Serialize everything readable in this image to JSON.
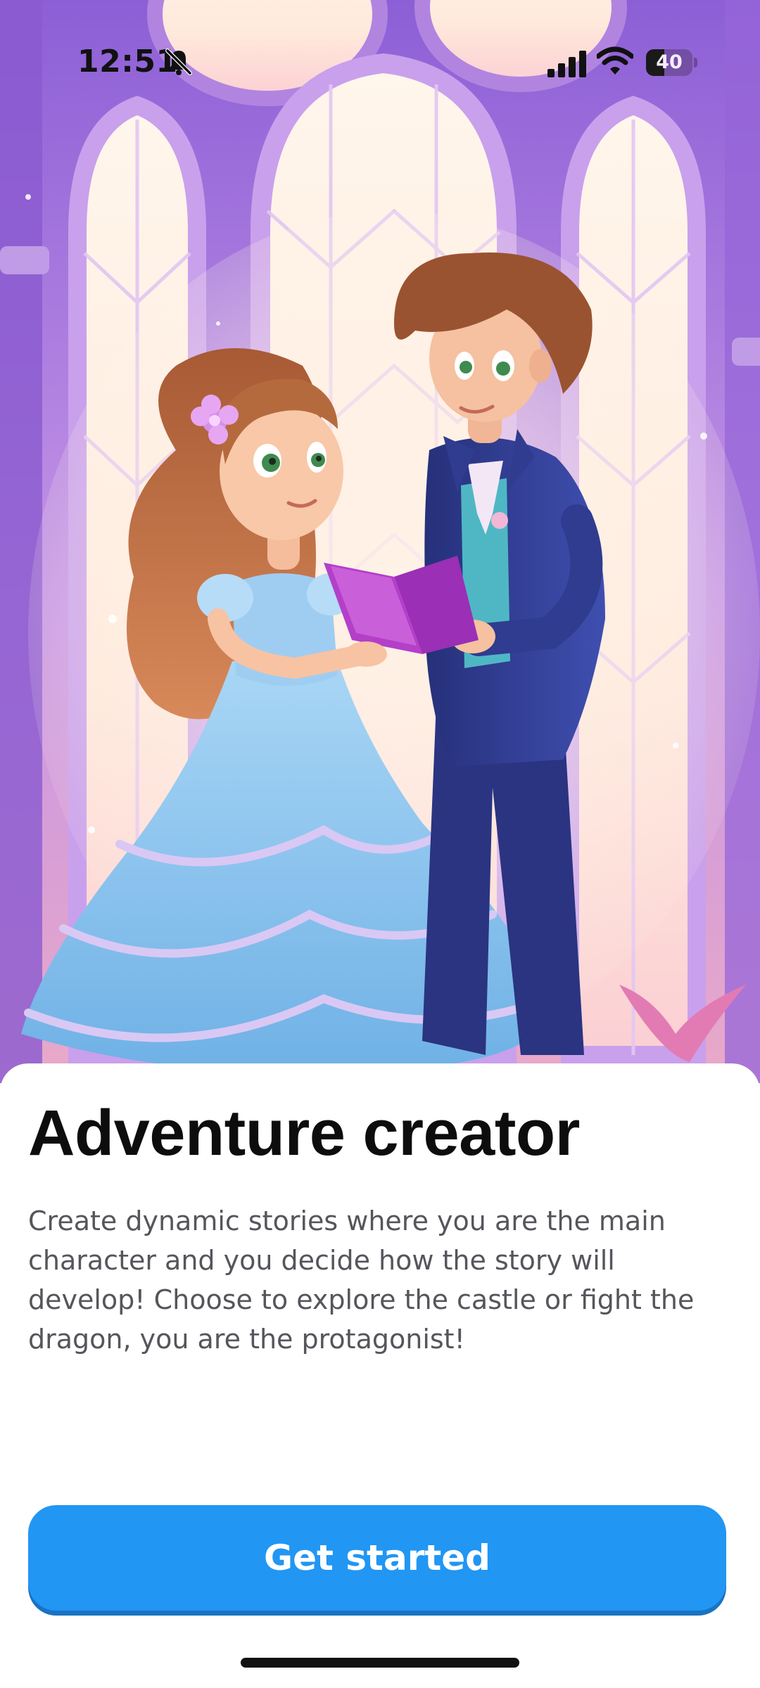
{
  "status_bar": {
    "time": "12:51",
    "mute_icon": "bell-slash-icon",
    "signal_icon": "cellular-signal-icon",
    "wifi_icon": "wifi-icon",
    "battery_level": "40",
    "battery_percent": 40
  },
  "hero": {
    "image": "illustration-princess-and-prince-reading-book-in-castle"
  },
  "onboarding": {
    "title": "Adventure creator",
    "description": "Create dynamic stories where you are the main character and you decide how the story will develop! Choose to explore the castle or fight the dragon, you are the protagonist!",
    "cta_label": "Get started"
  },
  "colors": {
    "accent": "#2196f3",
    "accent_shadow": "#1a73c2",
    "title": "#0d0d0d",
    "body_text": "#55555c",
    "castle_purple": "#9b6ad8",
    "dress_blue": "#8ec6ef",
    "suit_navy": "#2f3c8f",
    "book_magenta": "#b43fc9"
  }
}
